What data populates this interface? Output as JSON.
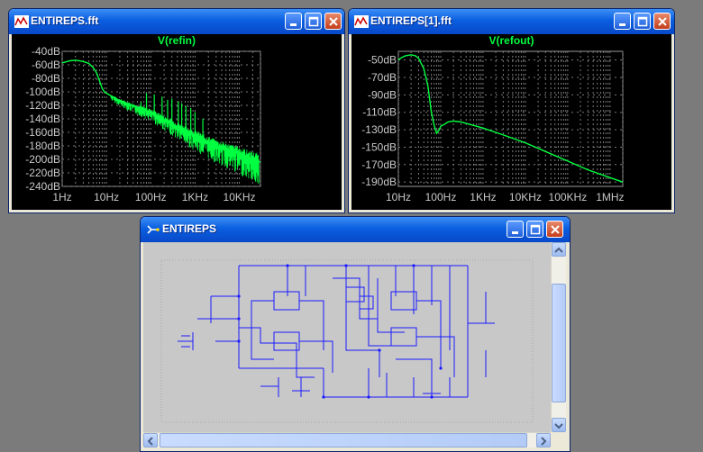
{
  "windows": {
    "fft1": {
      "title": "ENTIREPS.fft",
      "plot_title": "V(refin)",
      "y_ticks": [
        "-40dB",
        "-60dB",
        "-80dB",
        "-100dB",
        "-120dB",
        "-140dB",
        "-160dB",
        "-180dB",
        "-200dB",
        "-220dB",
        "-240dB"
      ],
      "x_ticks": [
        "1Hz",
        "10Hz",
        "100Hz",
        "1KHz",
        "10KHz"
      ]
    },
    "fft2": {
      "title": "ENTIREPS[1].fft",
      "plot_title": "V(refout)",
      "y_ticks": [
        "-50dB",
        "-70dB",
        "-90dB",
        "-110dB",
        "-130dB",
        "-150dB",
        "-170dB",
        "-190dB"
      ],
      "x_ticks": [
        "10Hz",
        "100Hz",
        "1KHz",
        "10KHz",
        "100KHz",
        "1MHz"
      ]
    },
    "schematic": {
      "title": "ENTIREPS"
    }
  },
  "colors": {
    "trace": "#00ff40",
    "grid": "#7a7a7a",
    "wire": "#0000ff",
    "titlebar": "#0a5fe0"
  },
  "icons": {
    "fft_window": "waveform-icon",
    "schematic_window": "schematic-icon"
  },
  "chart_data": [
    {
      "type": "line",
      "title": "V(refin)",
      "x_scale": "log",
      "xlim": [
        1,
        30000
      ],
      "ylim": [
        -240,
        -40
      ],
      "x_ticks": [
        "1Hz",
        "10Hz",
        "100Hz",
        "1KHz",
        "10KHz"
      ],
      "y_ticks": [
        "-40dB",
        "-60dB",
        "-80dB",
        "-100dB",
        "-120dB",
        "-140dB",
        "-160dB",
        "-180dB",
        "-200dB",
        "-220dB",
        "-240dB"
      ],
      "series": [
        {
          "x": [
            1,
            1.5,
            2,
            3,
            4,
            5,
            6,
            7,
            8,
            9,
            10,
            12,
            15,
            20,
            30,
            50,
            100,
            200,
            500,
            1000,
            3000,
            10000,
            20000,
            30000
          ],
          "y": [
            -57,
            -54,
            -53,
            -55,
            -58,
            -64,
            -72,
            -84,
            -95,
            -100,
            -102,
            -105,
            -109,
            -113,
            -118,
            -123,
            -130,
            -141,
            -155,
            -165,
            -180,
            -192,
            -200,
            -204
          ]
        }
      ]
    },
    {
      "type": "line",
      "title": "V(refout)",
      "x_scale": "log",
      "xlim": [
        10,
        2000000
      ],
      "ylim": [
        -195,
        -40
      ],
      "x_ticks": [
        "10Hz",
        "100Hz",
        "1KHz",
        "10KHz",
        "100KHz",
        "1MHz"
      ],
      "y_ticks": [
        "-50dB",
        "-70dB",
        "-90dB",
        "-110dB",
        "-130dB",
        "-150dB",
        "-170dB",
        "-190dB"
      ],
      "series": [
        {
          "x": [
            10,
            12,
            15,
            20,
            25,
            30,
            40,
            50,
            60,
            70,
            80,
            90,
            100,
            120,
            150,
            200,
            300,
            500,
            1000,
            3000,
            10000,
            30000,
            100000,
            300000,
            1000000,
            2000000
          ],
          "y": [
            -50,
            -47,
            -45,
            -44,
            -45,
            -48,
            -60,
            -80,
            -110,
            -125,
            -134,
            -131,
            -126,
            -124,
            -121,
            -120,
            -121,
            -124,
            -128,
            -136,
            -145,
            -155,
            -166,
            -176,
            -185,
            -190
          ]
        }
      ]
    }
  ]
}
